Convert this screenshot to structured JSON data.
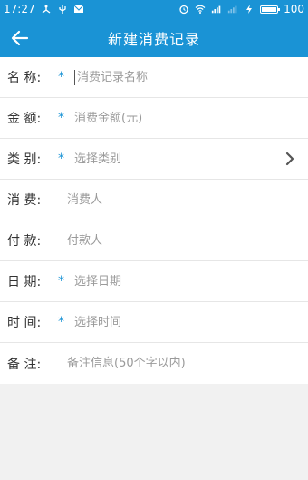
{
  "status_bar": {
    "time": "17:27",
    "battery": "100",
    "battery_level": 1.0
  },
  "header": {
    "title": "新建消费记录",
    "back_icon": "arrow-left-icon"
  },
  "form": {
    "rows": [
      {
        "label": "名 称:",
        "required": true,
        "placeholder": "消费记录名称"
      },
      {
        "label": "金 额:",
        "required": true,
        "placeholder": "消费金额(元)"
      },
      {
        "label": "类 别:",
        "required": true,
        "placeholder": "选择类别",
        "has_chevron": true
      },
      {
        "label": "消 费:",
        "required": false,
        "placeholder": "消费人"
      },
      {
        "label": "付 款:",
        "required": false,
        "placeholder": "付款人"
      },
      {
        "label": "日 期:",
        "required": true,
        "placeholder": "选择日期"
      },
      {
        "label": "时 间:",
        "required": true,
        "placeholder": "选择时间"
      },
      {
        "label": "备 注:",
        "required": false,
        "placeholder": "备注信息(50个字以内)"
      }
    ],
    "required_mark": "*"
  },
  "colors": {
    "accent": "#1a93d5",
    "background": "#f1f1f1",
    "placeholder": "#9a9a9a"
  }
}
